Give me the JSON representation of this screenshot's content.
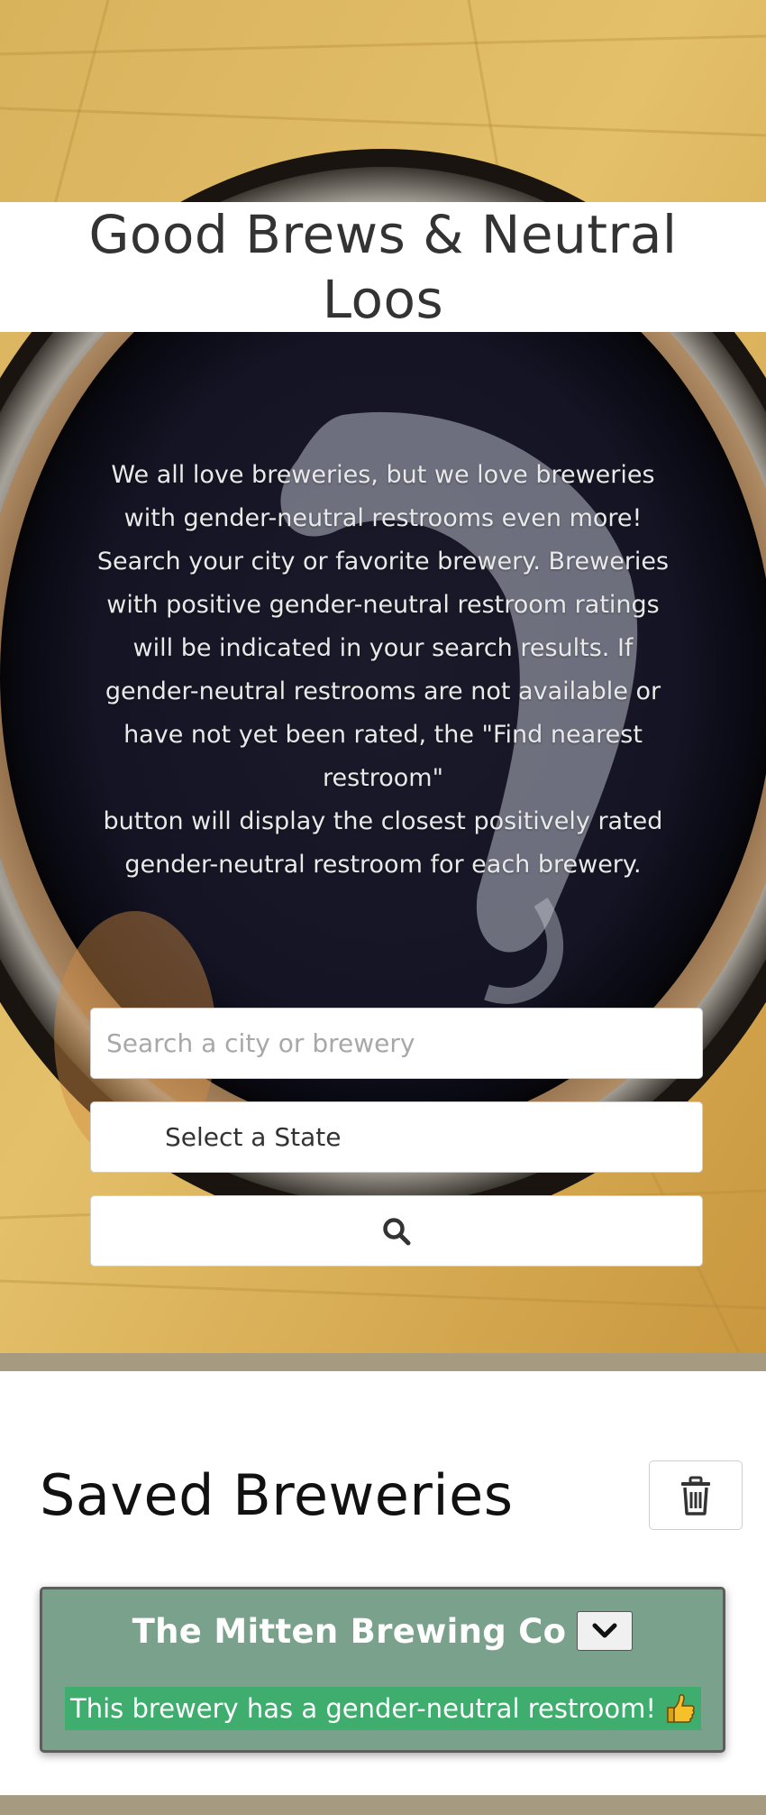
{
  "header": {
    "title": "Good Brews & Neutral Loos"
  },
  "intro": {
    "paragraph_1": "We all love breweries, but we love breweries with gender-neutral restrooms even more! Search your city or favorite brewery. Breweries with positive gender-neutral restroom ratings will be indicated in your search results. If gender-neutral restrooms are not available or have not yet been rated, the \"Find nearest restroom\"",
    "paragraph_2": "button will display the closest positively rated gender-neutral restroom for each brewery."
  },
  "search": {
    "placeholder": "Search a city or brewery",
    "value": "",
    "state_select_label": "Select a State",
    "button_icon": "search-icon"
  },
  "saved": {
    "title": "Saved Breweries",
    "clear_icon": "trash-icon",
    "breweries": [
      {
        "name": "The Mitten Brewing Co",
        "expand_icon": "chevron-down-icon",
        "restroom_status": "This brewery has a gender-neutral restroom!",
        "status_icon": "thumbs-up-icon"
      }
    ]
  },
  "colors": {
    "divider": "#a69a80",
    "card_background": "#7aa18c",
    "restroom_banner": "#3fad6e"
  }
}
